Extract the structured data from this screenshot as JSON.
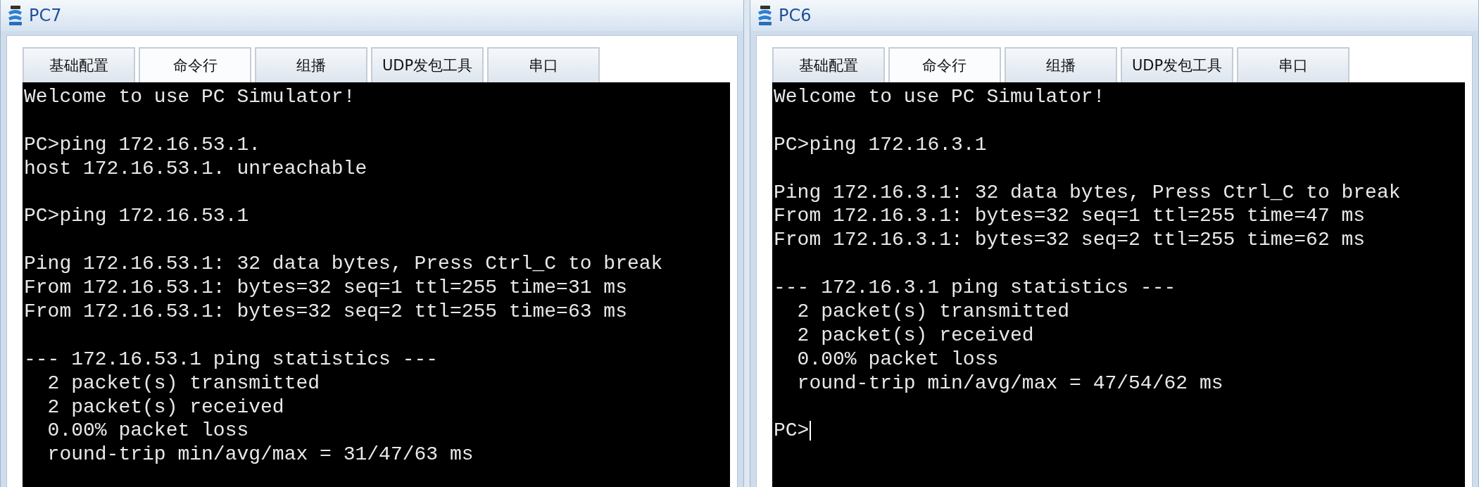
{
  "windows": [
    {
      "title": "PC7",
      "tabs": [
        {
          "label": "基础配置",
          "selected": false
        },
        {
          "label": "命令行",
          "selected": true
        },
        {
          "label": "组播",
          "selected": false
        },
        {
          "label": "UDP发包工具",
          "selected": false
        },
        {
          "label": "串口",
          "selected": false
        }
      ],
      "terminal": {
        "cursor": false,
        "blocks": [
          [
            "Welcome to use PC Simulator!"
          ],
          [
            "PC>ping 172.16.53.1.",
            "host 172.16.53.1. unreachable"
          ],
          [
            "PC>ping 172.16.53.1"
          ],
          [
            "Ping 172.16.53.1: 32 data bytes, Press Ctrl_C to break",
            "From 172.16.53.1: bytes=32 seq=1 ttl=255 time=31 ms",
            "From 172.16.53.1: bytes=32 seq=2 ttl=255 time=63 ms"
          ],
          [
            "--- 172.16.53.1 ping statistics ---",
            "  2 packet(s) transmitted",
            "  2 packet(s) received",
            "  0.00% packet loss",
            "  round-trip min/avg/max = 31/47/63 ms"
          ]
        ]
      }
    },
    {
      "title": "PC6",
      "tabs": [
        {
          "label": "基础配置",
          "selected": false
        },
        {
          "label": "命令行",
          "selected": true
        },
        {
          "label": "组播",
          "selected": false
        },
        {
          "label": "UDP发包工具",
          "selected": false
        },
        {
          "label": "串口",
          "selected": false
        }
      ],
      "terminal": {
        "cursor": true,
        "blocks": [
          [
            "Welcome to use PC Simulator!"
          ],
          [
            "PC>ping 172.16.3.1"
          ],
          [
            "Ping 172.16.3.1: 32 data bytes, Press Ctrl_C to break",
            "From 172.16.3.1: bytes=32 seq=1 ttl=255 time=47 ms",
            "From 172.16.3.1: bytes=32 seq=2 ttl=255 time=62 ms"
          ],
          [
            "--- 172.16.3.1 ping statistics ---",
            "  2 packet(s) transmitted",
            "  2 packet(s) received",
            "  0.00% packet loss",
            "  round-trip min/avg/max = 47/54/62 ms"
          ],
          [
            "PC>"
          ]
        ]
      }
    }
  ]
}
